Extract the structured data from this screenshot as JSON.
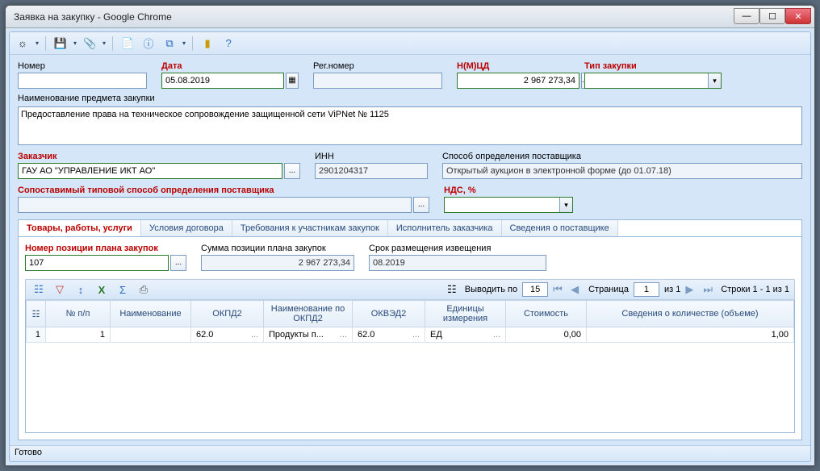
{
  "window": {
    "title": "Заявка на закупку - Google Chrome"
  },
  "form": {
    "number_label": "Номер",
    "number_value": "",
    "date_label": "Дата",
    "date_value": "05.08.2019",
    "regnum_label": "Рег.номер",
    "regnum_value": "",
    "nmcd_label": "Н(М)ЦД",
    "nmcd_value": "2 967 273,34",
    "type_label": "Тип закупки",
    "type_value": "",
    "subject_label": "Наименование предмета закупки",
    "subject_value": "Предоставление права на техническое сопровождение защищенной сети ViPNet № 1125",
    "customer_label": "Заказчик",
    "customer_value": "ГАУ АО \"УПРАВЛЕНИЕ ИКТ АО\"",
    "inn_label": "ИНН",
    "inn_value": "2901204317",
    "supplier_method_label": "Способ определения поставщика",
    "supplier_method_value": "Открытый аукцион в электронной форме (до 01.07.18)",
    "comparable_label": "Сопоставимый типовой способ определения поставщика",
    "comparable_value": "",
    "nds_label": "НДС, %",
    "nds_value": ""
  },
  "tabs": {
    "t1": "Товары, работы, услуги",
    "t2": "Условия договора",
    "t3": "Требования к участникам закупок",
    "t4": "Исполнитель заказчика",
    "t5": "Сведения о поставщике"
  },
  "plan": {
    "pos_label": "Номер позиции плана закупок",
    "pos_value": "107",
    "sum_label": "Сумма позиции плана закупок",
    "sum_value": "2 967 273,34",
    "deadline_label": "Срок размещения извещения",
    "deadline_value": "08.2019"
  },
  "pager": {
    "show_label": "Выводить по",
    "show_value": "15",
    "page_label": "Страница",
    "page_value": "1",
    "of_label": "из 1",
    "rows_label": "Строки 1 - 1 из 1"
  },
  "grid": {
    "cols": {
      "c1": "№ п/п",
      "c2": "Наименование",
      "c3": "ОКПД2",
      "c4": "Наименование по ОКПД2",
      "c5": "ОКВЭД2",
      "c6": "Единицы измерения",
      "c7": "Стоимость",
      "c8": "Сведения о количестве (объеме)"
    },
    "row": {
      "num": "1",
      "npp": "1",
      "name": "",
      "okpd2": "62.0",
      "okpd2name": "Продукты п...",
      "okved2": "62.0",
      "unit": "ЕД",
      "cost": "0,00",
      "qty": "1,00"
    }
  },
  "status": "Готово"
}
